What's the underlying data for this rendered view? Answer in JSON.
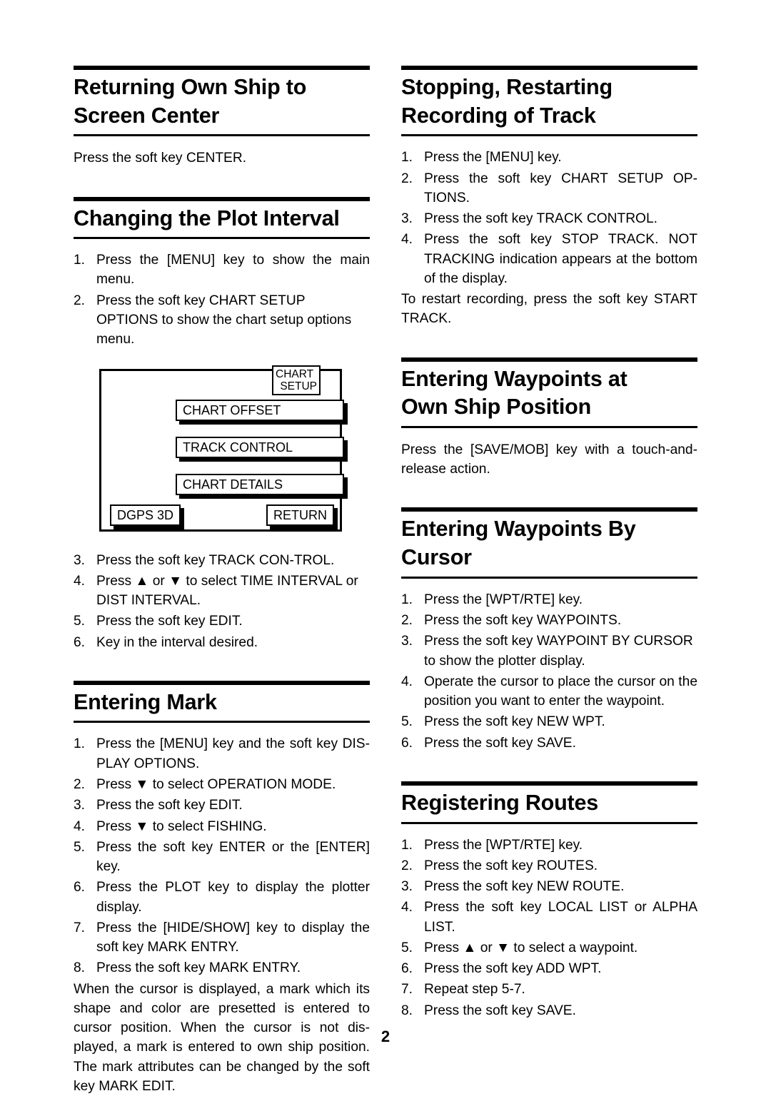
{
  "page": {
    "number": "2"
  },
  "left_column": {
    "sections": [
      {
        "id": "returning-own-ship-to-screen-center",
        "heading_lines": [
          "Returning Own Ship to",
          "Screen Center"
        ],
        "paragraph": "Press the soft key CENTER."
      },
      {
        "id": "changing-the-plot-interval",
        "heading_lines": [
          "Changing the Plot Interval"
        ],
        "steps_before_figure": [
          {
            "num": "1.",
            "text": "Press the [MENU] key to show the main menu."
          },
          {
            "num": "2.",
            "text": "Press the soft key CHART SETUP OPTIONS to show the chart setup options menu."
          }
        ],
        "figure": {
          "title_label_line1": "CHART",
          "title_label_line2": "SETUP",
          "soft_keys": [
            "CHART OFFSET",
            "TRACK CONTROL",
            "CHART DETAILS"
          ],
          "status_key": "DGPS 3D",
          "return_key": "RETURN"
        },
        "steps_after_figure": [
          {
            "num": "3.",
            "text": "Press the soft key TRACK CON-TROL."
          },
          {
            "num": "4.",
            "text": "Press ▲ or ▼ to select  TIME INTERVAL or DIST INTERVAL."
          },
          {
            "num": "5.",
            "text": "Press the soft key EDIT."
          },
          {
            "num": "6.",
            "text": "Key in the interval desired."
          }
        ]
      },
      {
        "id": "entering-mark",
        "heading_lines": [
          "Entering Mark"
        ],
        "steps": [
          {
            "num": "1.",
            "text": "Press the [MENU] key and the soft key DIS-PLAY OPTIONS."
          },
          {
            "num": "2.",
            "text": "Press ▼ to select OPERATION MODE."
          },
          {
            "num": "3.",
            "text": "Press the soft key EDIT."
          },
          {
            "num": "4.",
            "text": "Press ▼ to select FISHING."
          },
          {
            "num": "5.",
            "text": "Press the soft key ENTER or the [ENTER] key."
          },
          {
            "num": "6.",
            "text": "Press the PLOT key to display the plotter display."
          },
          {
            "num": "7.",
            "text": "Press the [HIDE/SHOW] key to display the soft key MARK ENTRY."
          },
          {
            "num": "8.",
            "text": "Press the soft key MARK ENTRY."
          }
        ],
        "note": "When the cursor is displayed, a mark which its shape and color are presetted is entered to cursor position. When the cursor is not dis-played, a mark is entered to own ship position. The mark attributes can be changed by the soft key MARK EDIT."
      }
    ]
  },
  "right_column": {
    "sections": [
      {
        "id": "stopping-restarting-recording-of-track",
        "heading_lines": [
          "Stopping, Restarting",
          "Recording of Track"
        ],
        "steps": [
          {
            "num": "1.",
            "text": "Press the [MENU] key."
          },
          {
            "num": "2.",
            "text": "Press the soft key CHART SETUP OP-TIONS."
          },
          {
            "num": "3.",
            "text": "Press the soft key TRACK CONTROL."
          },
          {
            "num": "4.",
            "text": "Press the soft key STOP TRACK. NOT TRACKING indication appears at the bottom of the display."
          }
        ],
        "note": "To restart recording, press the soft key START TRACK."
      },
      {
        "id": "entering-waypoints-at-own-ship-position",
        "heading_lines": [
          "Entering Waypoints at",
          "Own Ship Position"
        ],
        "paragraph": "Press the [SAVE/MOB] key with a touch-and-release action."
      },
      {
        "id": "entering-waypoints-by-cursor",
        "heading_lines": [
          "Entering Waypoints By",
          "Cursor"
        ],
        "steps": [
          {
            "num": "1.",
            "text": "Press the [WPT/RTE] key."
          },
          {
            "num": "2.",
            "text": "Press the soft key WAYPOINTS."
          },
          {
            "num": "3.",
            "text": "Press the soft key WAYPOINT BY CURSOR to show the plotter display."
          },
          {
            "num": "4.",
            "text": "Operate the cursor to place the cursor on the position you want to enter the waypoint."
          },
          {
            "num": "5.",
            "text": "Press the soft key NEW WPT."
          },
          {
            "num": "6.",
            "text": "Press the soft key SAVE."
          }
        ]
      },
      {
        "id": "registering-routes",
        "heading_lines": [
          "Registering Routes"
        ],
        "steps": [
          {
            "num": "1.",
            "text": "Press the [WPT/RTE] key."
          },
          {
            "num": "2.",
            "text": "Press the soft key ROUTES."
          },
          {
            "num": "3.",
            "text": "Press the soft key NEW ROUTE."
          },
          {
            "num": "4.",
            "text": "Press the soft key LOCAL LIST or ALPHA LIST."
          },
          {
            "num": "5.",
            "text": "Press ▲ or ▼ to select a waypoint."
          },
          {
            "num": "6.",
            "text": "Press the soft key ADD WPT."
          },
          {
            "num": "7.",
            "text": "Repeat step 5-7."
          },
          {
            "num": "8.",
            "text": "Press the soft key SAVE."
          }
        ]
      }
    ]
  }
}
